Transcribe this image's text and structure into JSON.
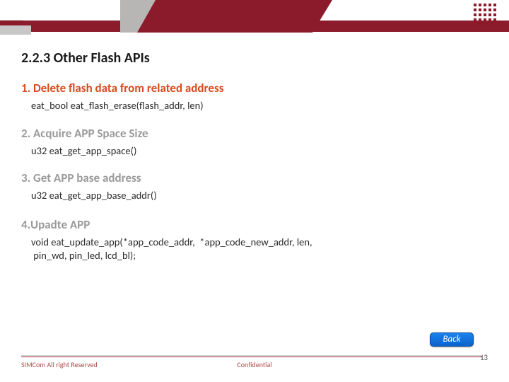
{
  "header": {
    "section_title": "2.2.3 Other Flash APIs"
  },
  "items": [
    {
      "title": "1. Delete flash data from related address",
      "code": "eat_bool eat_flash_erase(flash_addr, len)",
      "active": true
    },
    {
      "title": "2. Acquire APP Space Size",
      "code": "u32 eat_get_app_space()",
      "active": false
    },
    {
      "title": "3. Get APP base address",
      "code": "u32 eat_get_app_base_addr()",
      "active": false
    },
    {
      "title": "4.Upadte APP",
      "code": "void eat_update_app(*app_code_addr,  *app_code_new_addr, len,\n pin_wd, pin_led, lcd_bl);",
      "active": false
    }
  ],
  "back_button": {
    "label": "Back"
  },
  "footer": {
    "left": "SIMCom All right Reserved",
    "center": "Confidential",
    "page_number": "13"
  }
}
